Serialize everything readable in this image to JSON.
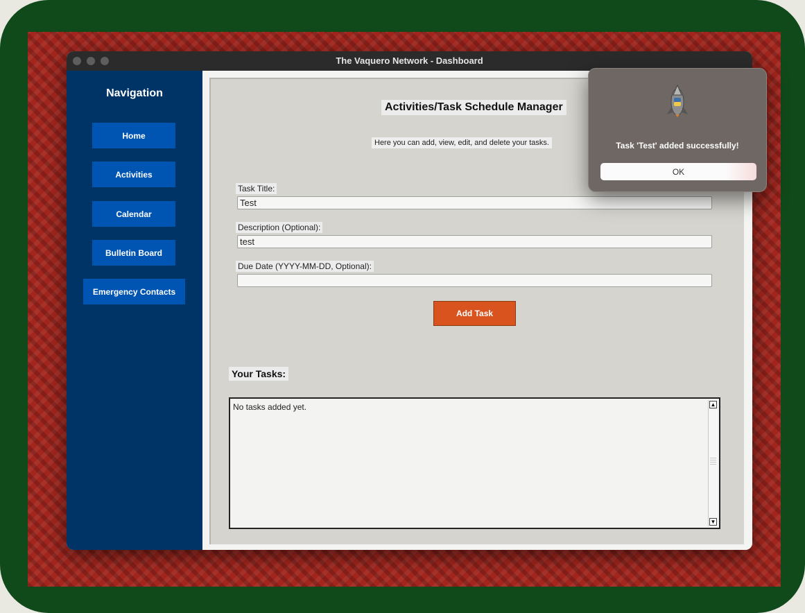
{
  "window": {
    "title": "The Vaquero Network - Dashboard"
  },
  "sidebar": {
    "title": "Navigation",
    "items": [
      {
        "label": "Home"
      },
      {
        "label": "Activities"
      },
      {
        "label": "Calendar"
      },
      {
        "label": "Bulletin Board"
      },
      {
        "label": "Emergency Contacts"
      }
    ]
  },
  "main": {
    "heading": "Activities/Task Schedule Manager",
    "intro": "Here you can add, view, edit, and delete your tasks.",
    "fields": {
      "title_label": "Task Title:",
      "title_value": "Test",
      "description_label": "Description (Optional):",
      "description_value": "test",
      "due_label": "Due Date (YYYY-MM-DD, Optional):",
      "due_value": ""
    },
    "add_button": "Add Task",
    "tasks_label": "Your Tasks:",
    "tasks_text": "No tasks added yet."
  },
  "dialog": {
    "icon": "python-rocket-icon",
    "message": "Task 'Test' added successfully!",
    "ok_label": "OK"
  },
  "colors": {
    "sidebar": "#003366",
    "nav_button": "#0055b3",
    "add_button": "#d9531e",
    "outer_frame": "#10491a",
    "wallpaper": "#a3261e"
  }
}
